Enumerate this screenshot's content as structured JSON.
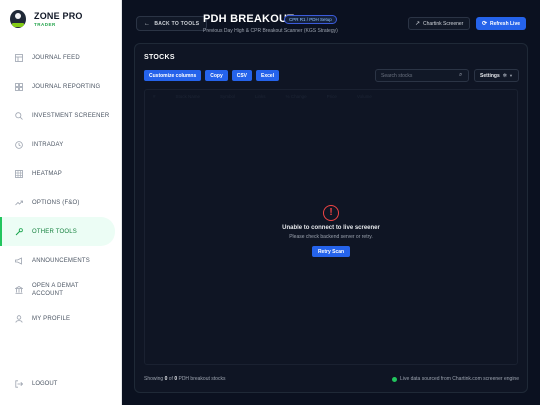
{
  "brand": {
    "title": "ZONE PRO",
    "subtitle": "TRADER"
  },
  "sidebar": {
    "items": [
      {
        "label": "JOURNAL FEED",
        "icon": "grid-icon"
      },
      {
        "label": "JOURNAL REPORTING",
        "icon": "report-icon"
      },
      {
        "label": "INVESTMENT SCREENER",
        "icon": "search-icon"
      },
      {
        "label": "INTRADAY",
        "icon": "clock-icon"
      },
      {
        "label": "HEATMAP",
        "icon": "heatmap-icon"
      },
      {
        "label": "OPTIONS (F&O)",
        "icon": "trend-icon"
      },
      {
        "label": "OTHER TOOLS",
        "icon": "wrench-icon",
        "active": true
      },
      {
        "label": "ANNOUNCEMENTS",
        "icon": "megaphone-icon"
      },
      {
        "label": "OPEN A DEMAT ACCOUNT",
        "icon": "bank-icon"
      },
      {
        "label": "MY PROFILE",
        "icon": "user-icon"
      }
    ],
    "logout": "LOGOUT"
  },
  "header": {
    "back": "BACK TO TOOLS",
    "title": "PDH BREAKOUT",
    "badge": "CPR R1 / PDH Setup",
    "subtitle": "Previous Day High & CPR Breakout Scanner (KGS Strategy)",
    "chartink": "Chartink Screener",
    "refresh": "Refresh Live"
  },
  "panel": {
    "title": "STOCKS",
    "toolbar": [
      "Customize columns",
      "Copy",
      "CSV",
      "Excel"
    ],
    "search_placeholder": "Search stocks",
    "settings": "Settings",
    "columns": [
      "#",
      "Stock Name",
      "Symbol",
      "Links",
      "% Change",
      "Price",
      "Volume"
    ],
    "error": {
      "icon": "!",
      "title": "Unable to connect to live screener",
      "subtitle": "Please check backend server or retry.",
      "retry": "Retry Scan"
    },
    "footer": {
      "prefix": "Showing ",
      "shown": "0",
      "of": " of ",
      "total": "0",
      "suffix": " PDH breakout stocks",
      "source": "Live data sourced from Chartink.com screener engine"
    }
  },
  "colors": {
    "accent": "#2563eb",
    "active": "#22c55e",
    "error": "#ef4444",
    "background": "#0b1120"
  }
}
